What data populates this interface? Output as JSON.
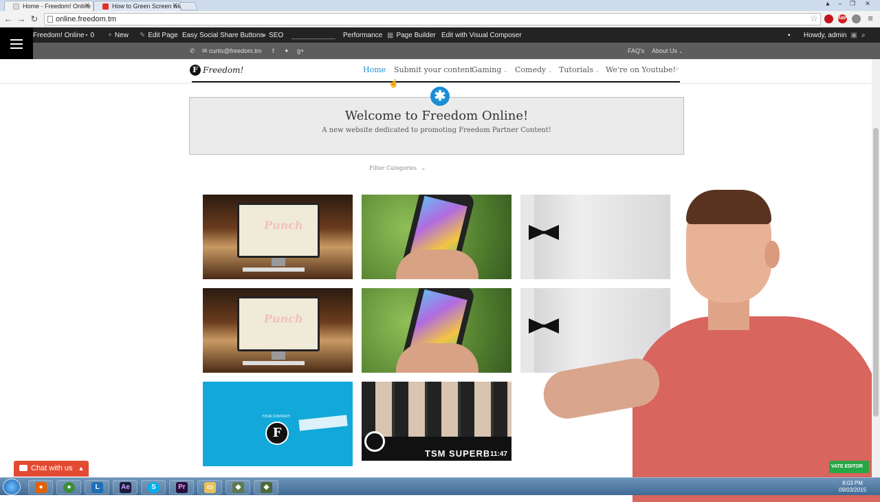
{
  "browser": {
    "tabs": [
      {
        "title": "Home - Freedom! Online",
        "favicon_color": "#dddddd"
      },
      {
        "title": "How to Green Screen with",
        "favicon_color": "#e52d27"
      }
    ],
    "url": "online.freedom.tm"
  },
  "adminbar": {
    "site": "Freedom! Online",
    "comments": "0",
    "new": "New",
    "edit_page": "Edit Page",
    "social": "Easy Social Share Buttons",
    "seo": "SEO",
    "performance": "Performance",
    "page_builder": "Page Builder",
    "visual_composer": "Edit with Visual Composer",
    "howdy": "Howdy, admin"
  },
  "topbar": {
    "email": "curtis@freedom.tm",
    "faqs": "FAQ's",
    "about": "About Us"
  },
  "header": {
    "logo_letter": "F",
    "logo_text": "Freedom!",
    "menu": [
      {
        "label": "Home",
        "active": true,
        "dropdown": false
      },
      {
        "label": "Submit your content",
        "active": false,
        "dropdown": false
      },
      {
        "label": "Gaming",
        "active": false,
        "dropdown": true
      },
      {
        "label": "Comedy",
        "active": false,
        "dropdown": true
      },
      {
        "label": "Tutorials",
        "active": false,
        "dropdown": true
      },
      {
        "label": "We're on Youtube!",
        "active": false,
        "dropdown": false
      }
    ]
  },
  "welcome": {
    "title": "Welcome to Freedom Online!",
    "subtitle": "A new website dedicated to promoting Freedom Partner Content!"
  },
  "filter": {
    "label": "Filter Categories"
  },
  "tiles": {
    "desk_text": "Punch",
    "blue_small": "YOUR CONTENT!",
    "blue_letter": "F",
    "tsm_title": "TSM SUPERBC",
    "tsm_duration": "11:47"
  },
  "chat": {
    "label": "Chat with us"
  },
  "private_editor": {
    "label": "VATE EDITOR"
  },
  "taskbar": {
    "time": "8:03 PM",
    "date": "09/03/2015"
  },
  "colors": {
    "accent": "#1a8fd6",
    "chat": "#e24b33",
    "adminbar": "#232323"
  }
}
